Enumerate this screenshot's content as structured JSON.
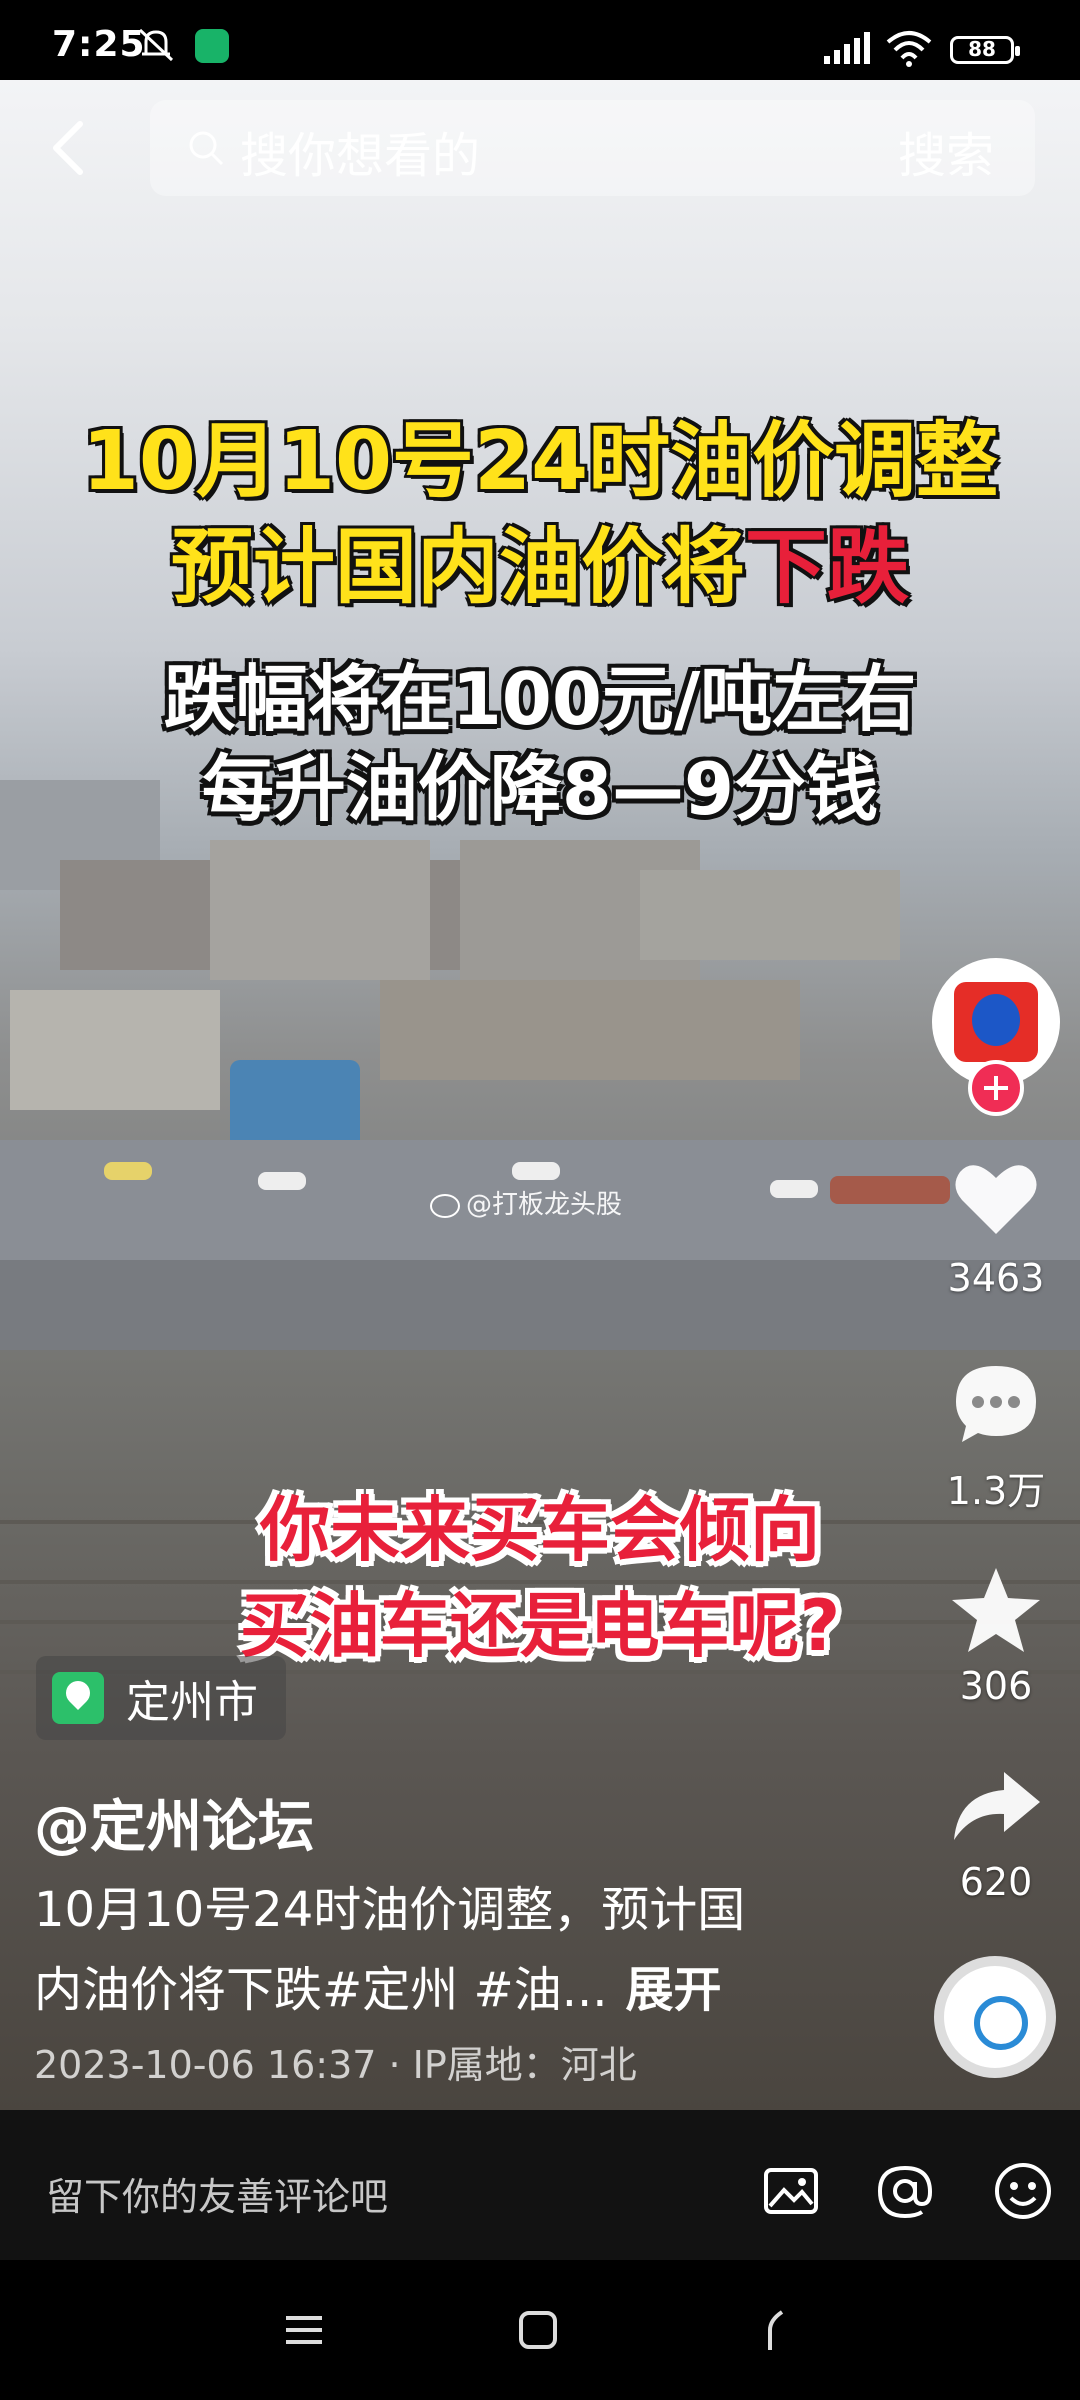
{
  "status_bar": {
    "time": "7:25",
    "battery": "88",
    "icons": [
      "bell-muted-icon",
      "shield-icon",
      "signal-icon",
      "wifi-icon",
      "battery-icon"
    ]
  },
  "search": {
    "placeholder": "搜你想看的",
    "button_label": "搜索"
  },
  "video": {
    "headline_line1": "10月10号24时油价调整",
    "headline_line2_prefix": "预计国内油价将",
    "headline_line2_highlight": "下跌",
    "sub_line1": "跌幅将在100元/吨左右",
    "sub_line2": "每升油价降8—9分钱",
    "watermark": "@打板龙头股",
    "question_line1": "你未来买车会倾向",
    "question_line2": "买油车还是电车呢?"
  },
  "actions": {
    "likes": "3463",
    "comments": "1.3万",
    "favorites": "306",
    "shares": "620"
  },
  "post": {
    "location": "定州市",
    "author": "@定州论坛",
    "description_line1": "10月10号24时油价调整，预计国",
    "description_line2": "内油价将下跌#定州 #油...",
    "expand_label": "展开",
    "meta": "2023-10-06 16:37 · IP属地：河北"
  },
  "comment_bar": {
    "placeholder": "留下你的友善评论吧"
  },
  "colors": {
    "headline_yellow": "#ffe21a",
    "accent_red": "#e8203a",
    "follow_pink": "#f02d55",
    "location_green": "#2cc06a"
  }
}
